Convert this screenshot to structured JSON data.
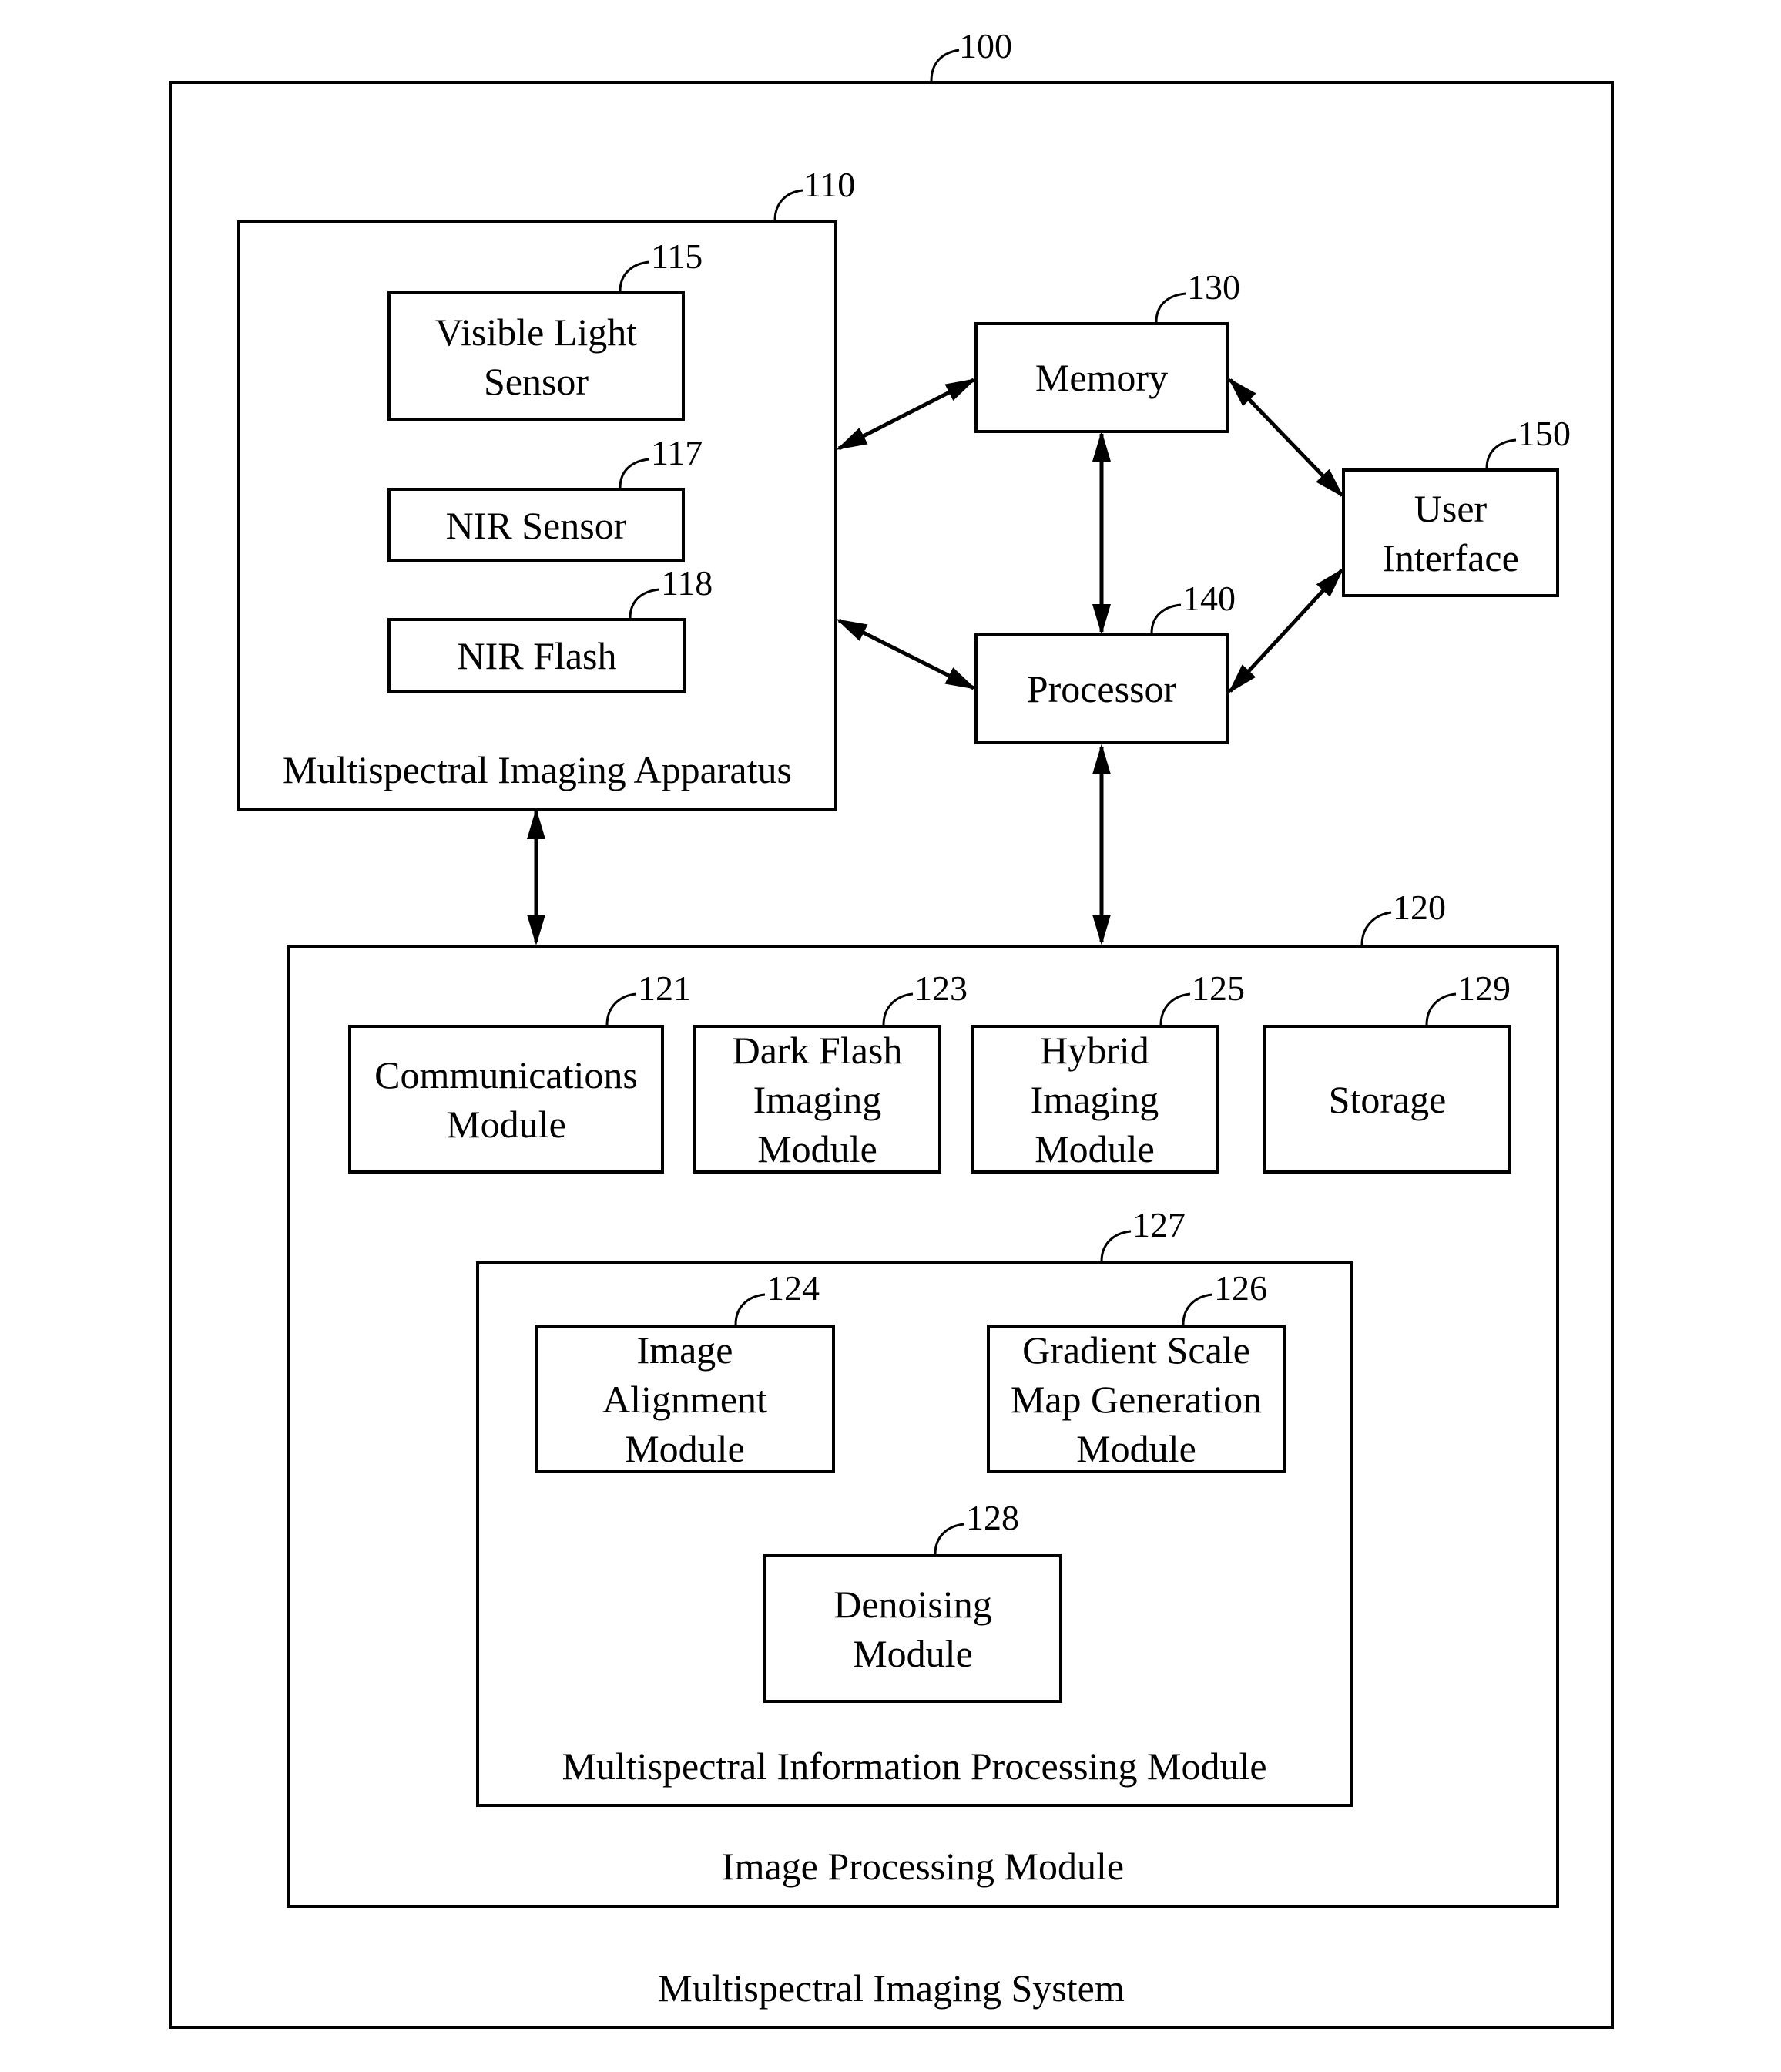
{
  "diagram": {
    "system": {
      "ref": "100",
      "title": "Multispectral Imaging System"
    },
    "apparatus": {
      "ref": "110",
      "title": "Multispectral Imaging Apparatus",
      "components": [
        {
          "ref": "115",
          "label": "Visible Light\nSensor"
        },
        {
          "ref": "117",
          "label": "NIR Sensor"
        },
        {
          "ref": "118",
          "label": "NIR Flash"
        }
      ]
    },
    "memory": {
      "ref": "130",
      "label": "Memory"
    },
    "processor": {
      "ref": "140",
      "label": "Processor"
    },
    "user_interface": {
      "ref": "150",
      "label": "User\nInterface"
    },
    "image_processing": {
      "ref": "120",
      "title": "Image Processing Module",
      "modules": [
        {
          "ref": "121",
          "label": "Communications\nModule"
        },
        {
          "ref": "123",
          "label": "Dark Flash\nImaging\nModule"
        },
        {
          "ref": "125",
          "label": "Hybrid\nImaging\nModule"
        },
        {
          "ref": "129",
          "label": "Storage"
        }
      ],
      "multispectral_info": {
        "ref": "127",
        "title": "Multispectral Information Processing Module",
        "modules": [
          {
            "ref": "124",
            "label": "Image\nAlignment\nModule"
          },
          {
            "ref": "126",
            "label": "Gradient Scale\nMap Generation\nModule"
          },
          {
            "ref": "128",
            "label": "Denoising\nModule"
          }
        ]
      }
    },
    "connections": [
      {
        "from": "apparatus",
        "to": "memory",
        "type": "bidirectional"
      },
      {
        "from": "apparatus",
        "to": "processor",
        "type": "bidirectional"
      },
      {
        "from": "memory",
        "to": "processor",
        "type": "bidirectional"
      },
      {
        "from": "memory",
        "to": "user_interface",
        "type": "bidirectional"
      },
      {
        "from": "processor",
        "to": "user_interface",
        "type": "bidirectional"
      },
      {
        "from": "apparatus",
        "to": "image_processing",
        "type": "bidirectional"
      },
      {
        "from": "processor",
        "to": "image_processing",
        "type": "bidirectional"
      }
    ]
  }
}
